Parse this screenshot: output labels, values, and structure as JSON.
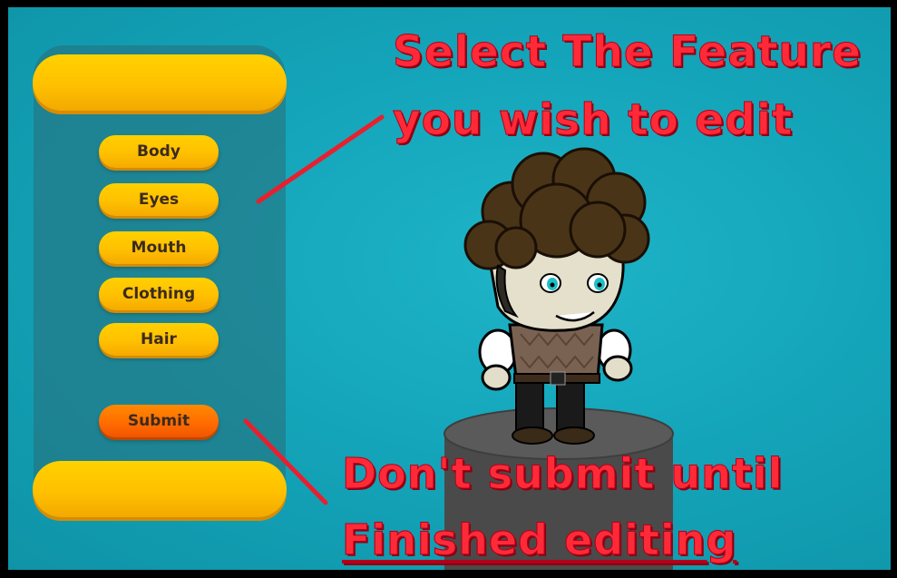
{
  "menu": {
    "items": [
      {
        "label": "Body"
      },
      {
        "label": "Eyes"
      },
      {
        "label": "Mouth"
      },
      {
        "label": "Clothing"
      },
      {
        "label": "Hair"
      }
    ],
    "submit_label": "Submit"
  },
  "annotations": {
    "top_line1": "Select The Feature",
    "top_line2": "you wish to edit",
    "bottom_line1": "Don't submit until",
    "bottom_line2": "Finished editing"
  },
  "colors": {
    "background": "#14a5ba",
    "button_yellow": "#ffc000",
    "button_orange": "#ff6a00",
    "annotation_red": "#ff2a38"
  }
}
